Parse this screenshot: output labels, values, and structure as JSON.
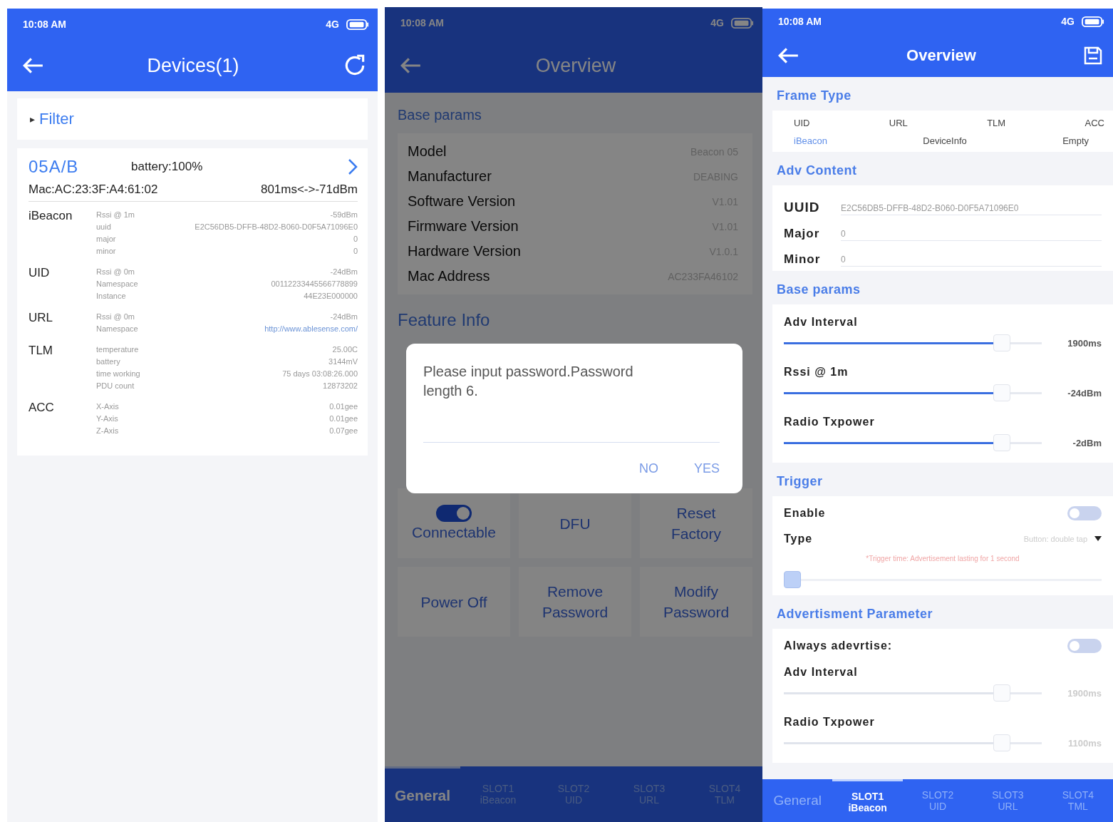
{
  "devices_screen": {
    "status_bar": {
      "time": "10:08 AM",
      "network": "4G"
    },
    "title": "Devices(1)",
    "filter": {
      "arrow": "▸",
      "label": "Filter"
    },
    "device": {
      "name": "05A/B",
      "battery": "battery:100%",
      "mac": "Mac:AC:23:3F:A4:61:02",
      "signal": "801ms<->-71dBm",
      "frames": [
        {
          "name": "iBeacon",
          "fields": [
            {
              "key": "Rssi @ 1m",
              "value": "-59dBm",
              "kind": "text"
            },
            {
              "key": "uuid",
              "value": "E2C56DB5-DFFB-48D2-B060-D0F5A71096E0",
              "kind": "text"
            },
            {
              "key": "major",
              "value": "0",
              "kind": "text"
            },
            {
              "key": "minor",
              "value": "0",
              "kind": "text"
            }
          ]
        },
        {
          "name": "UID",
          "fields": [
            {
              "key": "Rssi @ 0m",
              "value": "-24dBm",
              "kind": "text"
            },
            {
              "key": "Namespace",
              "value": "00112233445566778899",
              "kind": "text"
            },
            {
              "key": "Instance",
              "value": "44E23E000000",
              "kind": "text"
            }
          ]
        },
        {
          "name": "URL",
          "fields": [
            {
              "key": "Rssi @ 0m",
              "value": "-24dBm",
              "kind": "text"
            },
            {
              "key": "Namespace",
              "value": "http://www.ablesense.com/",
              "kind": "link"
            }
          ]
        },
        {
          "name": "TLM",
          "fields": [
            {
              "key": "temperature",
              "value": "25.00C",
              "kind": "text"
            },
            {
              "key": "battery",
              "value": "3144mV",
              "kind": "text"
            },
            {
              "key": "time working",
              "value": "75 days 03:08:26.000",
              "kind": "text"
            },
            {
              "key": "PDU count",
              "value": "12873202",
              "kind": "text"
            }
          ]
        },
        {
          "name": "ACC",
          "fields": [
            {
              "key": "X-Axis",
              "value": "0.01gee",
              "kind": "text"
            },
            {
              "key": "Y-Axis",
              "value": "0.01gee",
              "kind": "text"
            },
            {
              "key": "Z-Axis",
              "value": "0.07gee",
              "kind": "text"
            }
          ]
        }
      ]
    }
  },
  "overview_screen": {
    "status_bar": {
      "time": "10:08 AM",
      "network": "4G"
    },
    "title": "Overview",
    "base_params": {
      "title": "Base params",
      "rows": [
        {
          "label": "Model",
          "value": "Beacon 05"
        },
        {
          "label": "Manufacturer",
          "value": "DEABING"
        },
        {
          "label": "Software Version",
          "value": "V1.01"
        },
        {
          "label": "Firmware Version",
          "value": "V1.01"
        },
        {
          "label": "Hardware Version",
          "value": "V1.0.1"
        },
        {
          "label": "Mac Address",
          "value": "AC233FA46102"
        }
      ]
    },
    "feature_info": {
      "title": "Feature Info",
      "tiles": [
        {
          "label": "Connectable",
          "kind": "toggle",
          "on": true
        },
        {
          "label": "DFU",
          "kind": "action"
        },
        {
          "label": "Reset Factory",
          "kind": "action"
        },
        {
          "label": "Power Off",
          "kind": "action"
        },
        {
          "label": "Remove Password",
          "kind": "action"
        },
        {
          "label": "Modify Password",
          "kind": "action"
        }
      ]
    },
    "tabs": [
      {
        "title": "General",
        "selected": true
      },
      {
        "title": "SLOT1",
        "subtitle": "iBeacon",
        "selected": false
      },
      {
        "title": "SLOT2",
        "subtitle": "UID",
        "selected": false
      },
      {
        "title": "SLOT3",
        "subtitle": "URL",
        "selected": false
      },
      {
        "title": "SLOT4",
        "subtitle": "TLM",
        "selected": false
      }
    ],
    "dialog": {
      "message": "Please input password.Password length 6.",
      "buttons": [
        "NO",
        "YES"
      ]
    }
  },
  "slot_screen": {
    "status_bar": {
      "time": "10:08 AM",
      "network": "4G"
    },
    "title": "Overview",
    "frame_type": {
      "title": "Frame Type",
      "row_1": [
        {
          "label": "UID",
          "selected": false
        },
        {
          "label": "URL",
          "selected": false
        },
        {
          "label": "TLM",
          "selected": false
        },
        {
          "label": "ACC",
          "selected": false
        }
      ],
      "row_2": [
        {
          "label": "iBeacon",
          "selected": true
        },
        {
          "label": "DeviceInfo",
          "selected": false
        },
        {
          "label": "Empty",
          "selected": false
        }
      ]
    },
    "adv_content": {
      "title": "Adv Content",
      "fields": [
        {
          "label": "UUID",
          "value": "E2C56DB5-DFFB-48D2-B060-D0F5A71096E0"
        },
        {
          "label": "Major",
          "value": "0"
        },
        {
          "label": "Minor",
          "value": "0"
        }
      ]
    },
    "base_params": {
      "title": "Base params",
      "sliders": [
        {
          "label": "Adv Interval",
          "reading": "1900ms",
          "level": 0.87
        },
        {
          "label": "Rssi @ 1m",
          "reading": "-24dBm",
          "level": 0.87
        },
        {
          "label": "Radio Txpower",
          "reading": "-2dBm",
          "level": 0.87
        }
      ]
    },
    "trigger": {
      "title": "Trigger",
      "enable": {
        "label": "Enable",
        "on": false
      },
      "type": {
        "label": "Type",
        "value": "Button: double tap"
      },
      "hint": "*Trigger time: Advertisement lasting for 1 second",
      "level": 0
    },
    "advertisement": {
      "title": "Advertisment Parameter",
      "always": {
        "label": "Always adevrtise:",
        "on": false
      },
      "disabled": true,
      "sliders": [
        {
          "label": "Adv Interval",
          "reading": "1900ms",
          "level": 0.87
        },
        {
          "label": "Radio Txpower",
          "reading": "1100ms",
          "level": 0.87
        }
      ]
    },
    "tabs": [
      {
        "title": "General",
        "selected": false
      },
      {
        "title": "SLOT1",
        "subtitle": "iBeacon",
        "selected": true
      },
      {
        "title": "SLOT2",
        "subtitle": "UID",
        "selected": false
      },
      {
        "title": "SLOT3",
        "subtitle": "URL",
        "selected": false
      },
      {
        "title": "SLOT4",
        "subtitle": "TML",
        "selected": false
      }
    ]
  }
}
